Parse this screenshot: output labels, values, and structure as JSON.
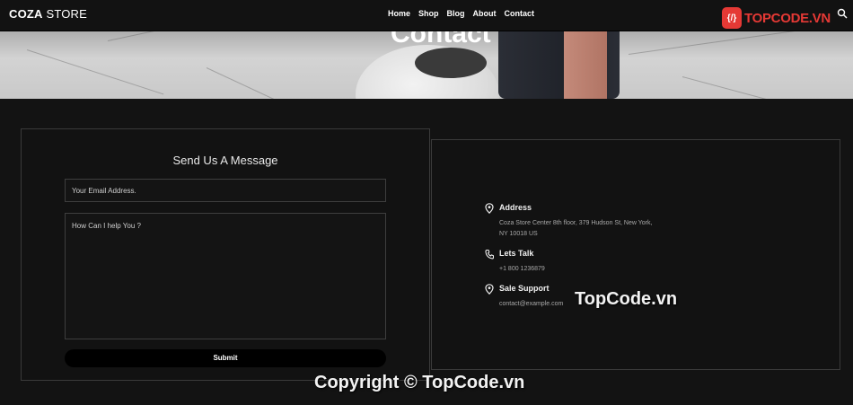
{
  "header": {
    "logo_bold": "COZA",
    "logo_rest": " STORE",
    "nav": [
      "Home",
      "Shop",
      "Blog",
      "About",
      "Contact"
    ]
  },
  "hero": {
    "title": "Contact"
  },
  "watermark": {
    "icon_text": "{/}",
    "brand": "TOPCODE.VN",
    "middle": "TopCode.vn",
    "copyright": "Copyright © TopCode.vn"
  },
  "form": {
    "title": "Send Us A Message",
    "email_placeholder": "Your Email Address.",
    "message_placeholder": "How Can I help You ?",
    "submit_label": "Submit"
  },
  "contact_info": {
    "address": {
      "label": "Address",
      "text": "Coza Store Center 8th floor, 379 Hudson St, New York, NY 10018 US"
    },
    "phone": {
      "label": "Lets Talk",
      "text": "+1 800 1236879"
    },
    "support": {
      "label": "Sale Support",
      "text": "contact@example.com"
    }
  },
  "colors": {
    "background": "#131313",
    "accent": "#e53935",
    "button": "#000000"
  }
}
